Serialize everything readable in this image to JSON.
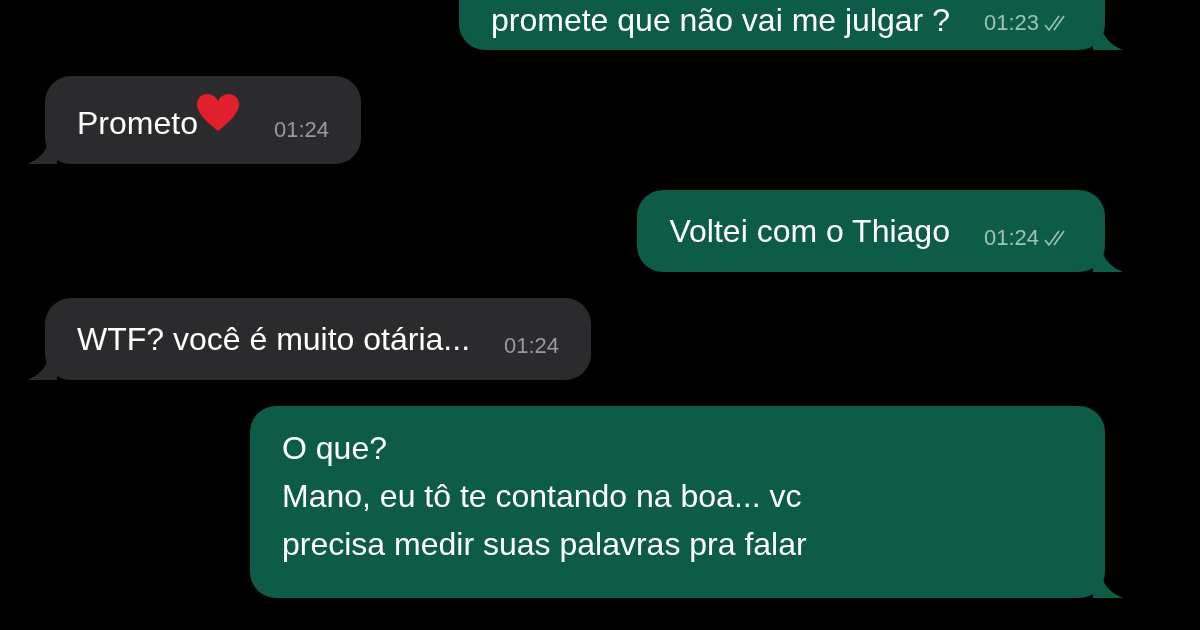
{
  "messages": [
    {
      "kind": "sent",
      "lines": [
        "promete que não vai me julgar ?"
      ],
      "time": "01:23",
      "read": true,
      "top": true
    },
    {
      "kind": "received",
      "lines": [
        "Prometo"
      ],
      "heart": true,
      "time": "01:24"
    },
    {
      "kind": "sent",
      "lines": [
        "Voltei com o Thiago"
      ],
      "time": "01:24",
      "read": true
    },
    {
      "kind": "received",
      "lines": [
        "WTF? você é muito otária..."
      ],
      "time": "01:24"
    },
    {
      "kind": "sent",
      "lines": [
        "O que?",
        "Mano, eu tô te contando na boa... vc",
        "precisa medir suas palavras pra falar"
      ]
    }
  ]
}
